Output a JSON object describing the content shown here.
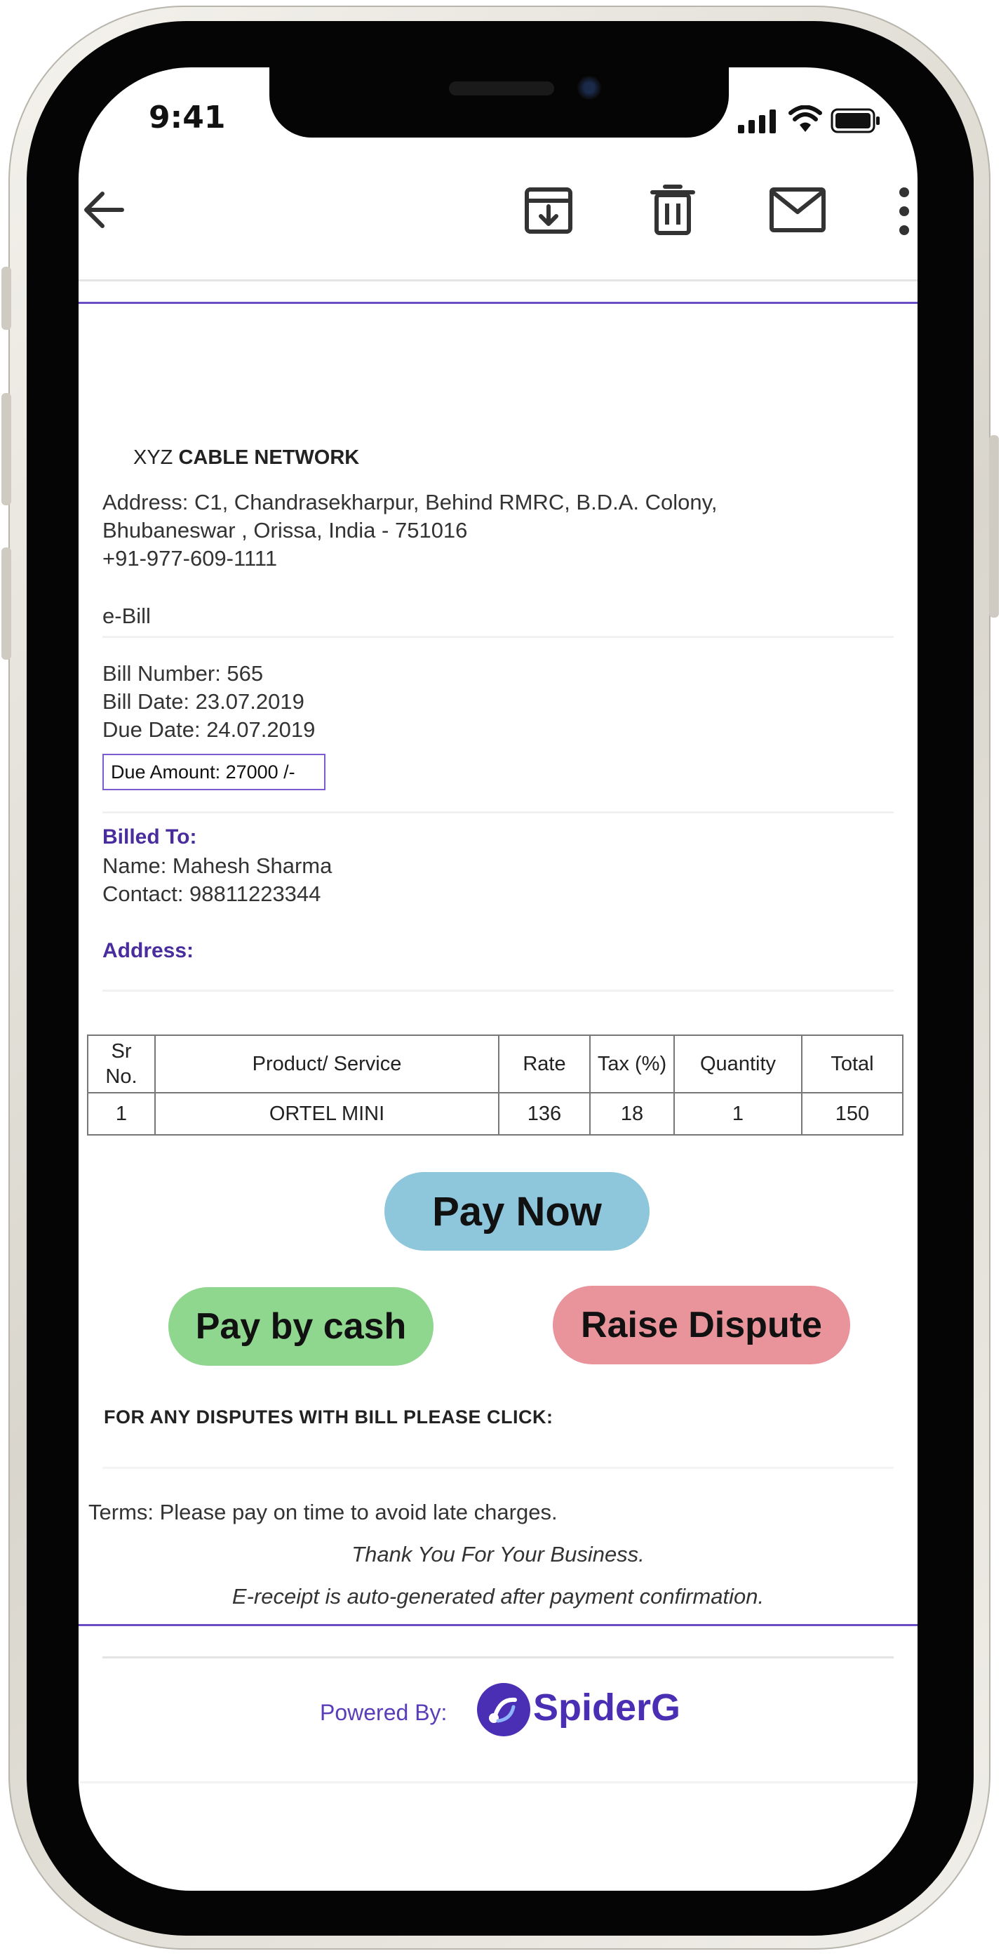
{
  "status_bar": {
    "time": "9:41"
  },
  "toolbar": {
    "back_icon": "arrow-left-icon",
    "archive_icon": "archive-download-icon",
    "delete_icon": "trash-icon",
    "mail_icon": "mail-icon",
    "more_icon": "more-vertical-icon"
  },
  "bill": {
    "business_prefix": "XYZ",
    "business_name": "CABLE NETWORK",
    "address_line1": "Address: C1, Chandrasekharpur, Behind RMRC, B.D.A. Colony,",
    "address_line2": "Bhubaneswar , Orissa, India - 751016",
    "phone": "+91-977-609-1111",
    "doc_type": "e-Bill",
    "bill_number": "Bill Number: 565",
    "bill_date": "Bill Date: 23.07.2019",
    "due_date": "Due Date: 24.07.2019",
    "due_amount": "Due Amount: 27000 /-",
    "billed_to_label": "Billed To:",
    "name": "Name: Mahesh Sharma",
    "contact": "Contact: 98811223344",
    "address_label": "Address:"
  },
  "table": {
    "headers": {
      "sr_line1": "Sr",
      "sr_line2": "No.",
      "product": "Product/ Service",
      "rate": "Rate",
      "tax": "Tax (%)",
      "quantity": "Quantity",
      "total": "Total"
    },
    "rows": [
      {
        "sr": "1",
        "product": "ORTEL MINI",
        "rate": "136",
        "tax": "18",
        "quantity": "1",
        "total": "150"
      }
    ]
  },
  "actions": {
    "pay_now": "Pay Now",
    "pay_by_cash": "Pay by cash",
    "raise_dispute": "Raise Dispute",
    "pay_now_color": "#8ec6dc",
    "pay_by_cash_color": "#8fd68f",
    "raise_dispute_color": "#e8949a"
  },
  "footer": {
    "dispute_note": "FOR ANY DISPUTES WITH BILL PLEASE CLICK:",
    "terms": "Terms: Please pay on time to avoid late charges.",
    "thanks": "Thank You For Your Business.",
    "receipt_note": "E-receipt is auto-generated after payment confirmation.",
    "powered_by": "Powered By:",
    "brand": "SpiderG",
    "brand_color": "#4a2fb5"
  }
}
